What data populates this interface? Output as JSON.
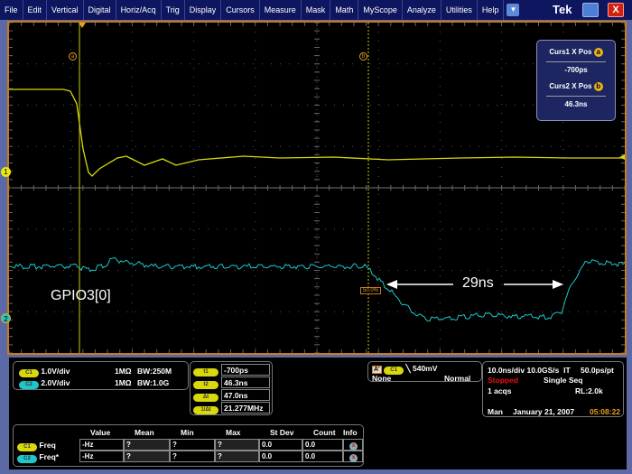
{
  "menu": [
    "File",
    "Edit",
    "Vertical",
    "Digital",
    "Horiz/Acq",
    "Trig",
    "Display",
    "Cursors",
    "Measure",
    "Mask",
    "Math",
    "MyScope",
    "Analyze",
    "Utilities",
    "Help"
  ],
  "brand": "Tek",
  "colors": {
    "ch1": "#d8d80c",
    "ch2": "#1cc8c8",
    "graticule_border": "#c87a1a",
    "cursor": "#c8c814"
  },
  "cursor_readout": {
    "curs1_label": "Curs1 X Pos",
    "curs1_value": "-700ps",
    "curs2_label": "Curs2 X Pos",
    "curs2_value": "46.3ns",
    "a": "a",
    "b": "b"
  },
  "annotations": {
    "signal_label": "GPIO3[0]",
    "duration": "29ns",
    "level": "50.0%"
  },
  "channel_markers": {
    "ch1": "1",
    "ch2": "2"
  },
  "channels": [
    {
      "pill": "C1",
      "scale": "1.0V/div",
      "impedance": "1MΩ",
      "bw": "BW:250M"
    },
    {
      "pill": "C2",
      "scale": "2.0V/div",
      "impedance": "1MΩ",
      "bw": "BW:1.0G"
    }
  ],
  "cursors_panel": [
    {
      "pill": "t1",
      "value": "-700ps"
    },
    {
      "pill": "t2",
      "value": "46.3ns"
    },
    {
      "pill": "Δt",
      "value": "47.0ns"
    },
    {
      "pill": "1/Δt",
      "value": "21.277MHz"
    }
  ],
  "trigger": {
    "source_badge": "A'",
    "pill": "C1",
    "level": "540mV",
    "coupling": "None",
    "mode": "Normal"
  },
  "acq": {
    "timebase": "10.0ns/div",
    "rate": "10.0GS/s",
    "it": "IT",
    "res": "50.0ps/pt",
    "status": "Stopped",
    "seq": "Single Seq",
    "acqs": "1 acqs",
    "rl": "RL:2.0k",
    "mode": "Man",
    "date": "January 21, 2007",
    "time": "05:08:22"
  },
  "measure": {
    "headers": [
      "Value",
      "Mean",
      "Min",
      "Max",
      "St Dev",
      "Count",
      "Info"
    ],
    "rows": [
      {
        "pill": "C1",
        "name": "Freq",
        "cells": [
          "-Hz",
          "?",
          "?",
          "?",
          "0.0",
          "0.0"
        ]
      },
      {
        "pill": "C2",
        "name": "Freq*",
        "cells": [
          "-Hz",
          "?",
          "?",
          "?",
          "0.0",
          "0.0"
        ]
      }
    ]
  }
}
